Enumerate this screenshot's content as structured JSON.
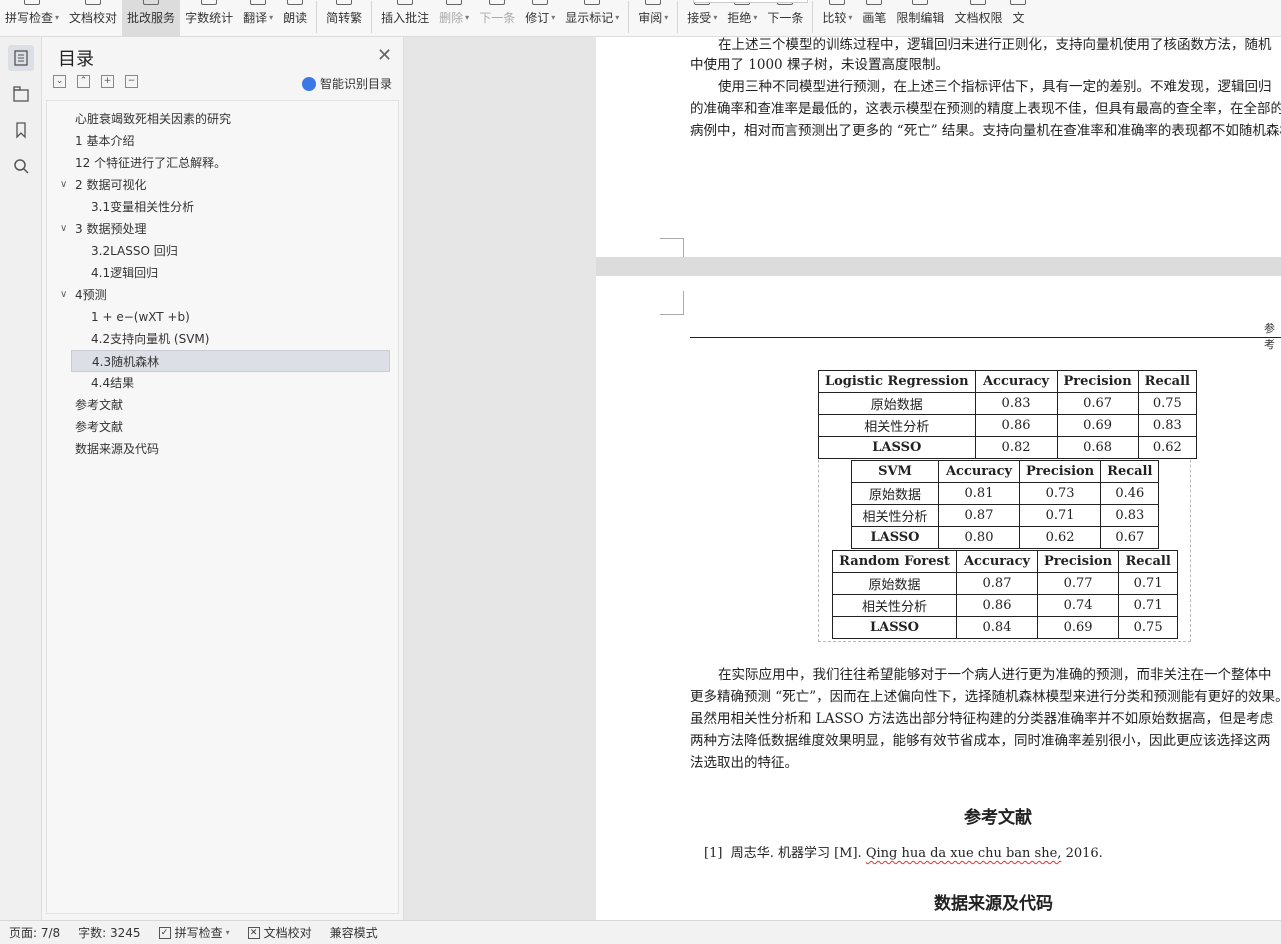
{
  "ribbon": {
    "items": [
      {
        "label": "拼写检查",
        "caret": true
      },
      {
        "label": "文档校对",
        "caret": false
      },
      {
        "label": "批改服务",
        "caret": false
      },
      {
        "label": "字数统计",
        "caret": false
      },
      {
        "label": "翻译",
        "caret": true
      },
      {
        "label": "朗读",
        "caret": false
      },
      {
        "label": "简转繁",
        "caret": false
      },
      {
        "label": "插入批注",
        "caret": false
      },
      {
        "label": "删除",
        "caret": true
      },
      {
        "label": "下一条",
        "caret": false
      },
      {
        "label": "修订",
        "caret": true
      },
      {
        "label": "显示标记",
        "caret": true
      },
      {
        "label": "审阅",
        "caret": true
      },
      {
        "label": "接受",
        "caret": true
      },
      {
        "label": "拒绝",
        "caret": true
      },
      {
        "label": "下一条",
        "caret": false
      },
      {
        "label": "比较",
        "caret": true
      },
      {
        "label": "画笔",
        "caret": false
      },
      {
        "label": "限制编辑",
        "caret": false
      },
      {
        "label": "文档权限",
        "caret": false
      },
      {
        "label": "文",
        "caret": false
      }
    ]
  },
  "toc": {
    "title": "目录",
    "smart_label": "智能识别目录",
    "items": [
      {
        "text": "心脏衰竭致死相关因素的研究",
        "level": 0,
        "chevron": false
      },
      {
        "text": "1 基本介绍",
        "level": 0,
        "chevron": false
      },
      {
        "text": "12 个特征进行了汇总解释。",
        "level": 0,
        "chevron": false
      },
      {
        "text": "2 数据可视化",
        "level": 0,
        "chevron": true
      },
      {
        "text": "3.1变量相关性分析",
        "level": 1,
        "chevron": false
      },
      {
        "text": "3 数据预处理",
        "level": 0,
        "chevron": true
      },
      {
        "text": "3.2LASSO 回归",
        "level": 1,
        "chevron": false
      },
      {
        "text": "4.1逻辑回归",
        "level": 1,
        "chevron": false
      },
      {
        "text": "4预测",
        "level": 0,
        "chevron": true
      },
      {
        "text": "1 + e−(wXT +b)",
        "level": 1,
        "chevron": false
      },
      {
        "text": "4.2支持向量机 (SVM)",
        "level": 1,
        "chevron": false
      },
      {
        "text": "4.3随机森林",
        "level": 1,
        "chevron": false,
        "selected": true
      },
      {
        "text": "4.4结果",
        "level": 1,
        "chevron": false
      },
      {
        "text": "参考文献",
        "level": 0,
        "chevron": false
      },
      {
        "text": "参考文献",
        "level": 0,
        "chevron": false
      },
      {
        "text": "数据来源及代码",
        "level": 0,
        "chevron": false
      }
    ]
  },
  "page1": {
    "lines": [
      "在上述三个模型的训练过程中，逻辑回归未进行正则化，支持向量机使用了核函数方法，随机",
      "中使用了 1000 棵子树，未设置高度限制。",
      "使用三种不同模型进行预测，在上述三个指标评估下，具有一定的差别。不难发现，逻辑回归",
      "的准确率和查准率是最低的，这表示模型在预测的精度上表现不佳，但具有最高的查全率，在全部的",
      "病例中，相对而言预测出了更多的 “死亡” 结果。支持向量机在查准率和准确率的表现都不如随机森林"
    ]
  },
  "page2": {
    "header_text": "参考",
    "tables": [
      {
        "model": "Logistic Regression",
        "columns": [
          "Accuracy",
          "Precision",
          "Recall"
        ],
        "rows": [
          {
            "name": "原始数据",
            "values": [
              "0.83",
              "0.67",
              "0.75"
            ]
          },
          {
            "name": "相关性分析",
            "values": [
              "0.86",
              "0.69",
              "0.83"
            ]
          },
          {
            "name": "LASSO",
            "values": [
              "0.82",
              "0.68",
              "0.62"
            ]
          }
        ]
      },
      {
        "model": "SVM",
        "columns": [
          "Accuracy",
          "Precision",
          "Recall"
        ],
        "rows": [
          {
            "name": "原始数据",
            "values": [
              "0.81",
              "0.73",
              "0.46"
            ]
          },
          {
            "name": "相关性分析",
            "values": [
              "0.87",
              "0.71",
              "0.83"
            ]
          },
          {
            "name": "LASSO",
            "values": [
              "0.80",
              "0.62",
              "0.67"
            ]
          }
        ]
      },
      {
        "model": "Random Forest",
        "columns": [
          "Accuracy",
          "Precision",
          "Recall"
        ],
        "rows": [
          {
            "name": "原始数据",
            "values": [
              "0.87",
              "0.77",
              "0.71"
            ]
          },
          {
            "name": "相关性分析",
            "values": [
              "0.86",
              "0.74",
              "0.71"
            ]
          },
          {
            "name": "LASSO",
            "values": [
              "0.84",
              "0.69",
              "0.75"
            ]
          }
        ]
      }
    ],
    "paragraph": [
      "在实际应用中，我们往往希望能够对于一个病人进行更为准确的预测，而非关注在一个整体中",
      "更多精确预测 “死亡”，因而在上述偏向性下，选择随机森林模型来进行分类和预测能有更好的效果。同",
      "虽然用相关性分析和 LASSO 方法选出部分特征构建的分类器准确率并不如原始数据高，但是考虑",
      "两种方法降低数据维度效果明显，能够有效节省成本，同时准确率差别很小，因此更应该选择这两",
      "法选取出的特征。"
    ],
    "ref_heading": "参考文献",
    "ref_number": "[1]",
    "ref_author": "周志华. 机器学习 [M].",
    "ref_publisher": "Qing hua da xue chu ban she,",
    "ref_year": "2016.",
    "data_heading": "数据来源及代码"
  },
  "status": {
    "page": "页面: 7/8",
    "words": "字数: 3245",
    "spell": "拼写检查",
    "proof": "文档校对",
    "compat": "兼容模式"
  }
}
